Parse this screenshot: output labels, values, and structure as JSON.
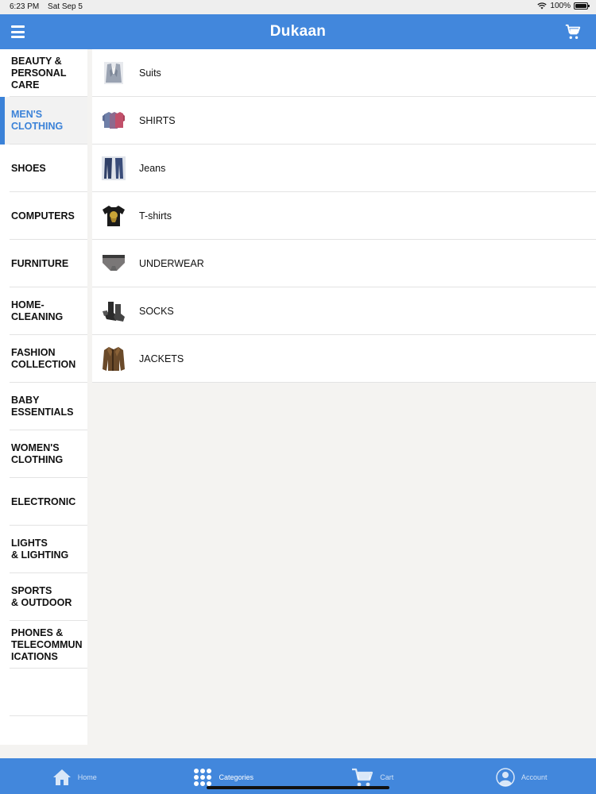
{
  "status_bar": {
    "time": "6:23 PM",
    "date": "Sat Sep 5",
    "battery": "100%"
  },
  "header": {
    "title": "Dukaan",
    "menu_icon": "hamburger-icon",
    "cart_icon": "cart-icon"
  },
  "sidebar": {
    "active_index": 1,
    "items": [
      {
        "label": "BEAUTY &\nPERSONAL\nCARE"
      },
      {
        "label": "MEN'S\nCLOTHING"
      },
      {
        "label": "SHOES"
      },
      {
        "label": "COMPUTERS"
      },
      {
        "label": "FURNITURE"
      },
      {
        "label": "HOME-\nCLEANING"
      },
      {
        "label": "FASHION\nCOLLECTION"
      },
      {
        "label": "BABY\nESSENTIALS"
      },
      {
        "label": "WOMEN'S\nCLOTHING"
      },
      {
        "label": "ELECTRONIC"
      },
      {
        "label": "LIGHTS\n& LIGHTING"
      },
      {
        "label": "SPORTS\n& OUTDOOR"
      },
      {
        "label": "PHONES &\nTELECOMMUN\nICATIONS"
      }
    ]
  },
  "subcategories": [
    {
      "label": "Suits",
      "icon": "suit-icon"
    },
    {
      "label": "SHIRTS",
      "icon": "shirts-icon"
    },
    {
      "label": "Jeans",
      "icon": "jeans-icon"
    },
    {
      "label": "T-shirts",
      "icon": "tshirt-icon"
    },
    {
      "label": "UNDERWEAR",
      "icon": "underwear-icon"
    },
    {
      "label": "SOCKS",
      "icon": "socks-icon"
    },
    {
      "label": "JACKETS",
      "icon": "jacket-icon"
    }
  ],
  "tabbar": {
    "active": "categories",
    "home_label": "Home",
    "categories_label": "Categories",
    "cart_label": "Cart",
    "account_label": "Account"
  },
  "colors": {
    "accent": "#4287dc",
    "active_text": "#3b82d8"
  }
}
